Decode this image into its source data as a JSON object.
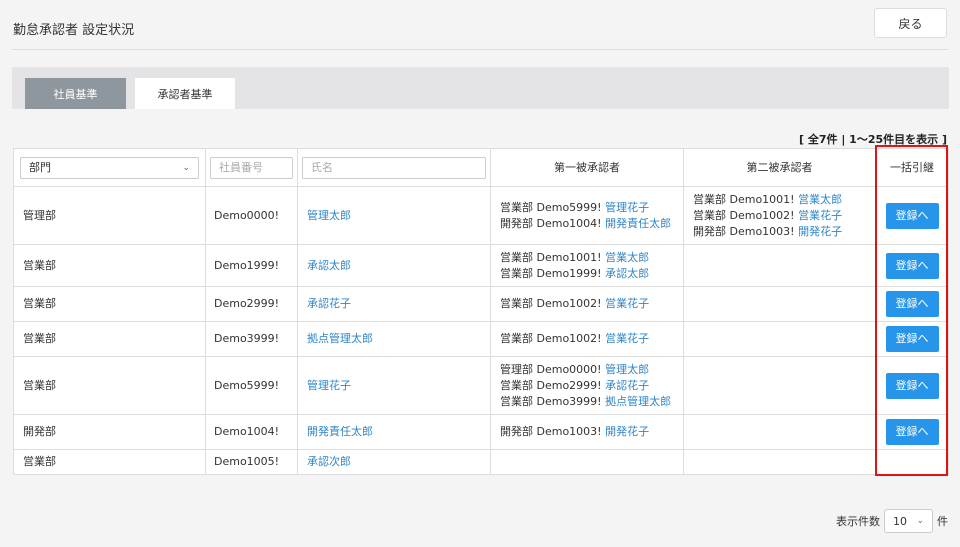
{
  "header": {
    "title": "勤怠承認者 設定状況",
    "back_label": "戻る"
  },
  "tabs": [
    {
      "label": "社員基準"
    },
    {
      "label": "承認者基準"
    }
  ],
  "count_text": "[ 全7件 | 1〜25件目を表示 ]",
  "filters": {
    "department": "部門",
    "employee_no_placeholder": "社員番号",
    "name_placeholder": "氏名"
  },
  "columns": {
    "first": "第一被承認者",
    "second": "第二被承認者",
    "bulk": "一括引継"
  },
  "register_label": "登録へ",
  "rows": [
    {
      "dept": "管理部",
      "id": "Demo0000!",
      "name": "管理太郎",
      "first": [
        {
          "prefix": "営業部 Demo5999!",
          "name": "管理花子"
        },
        {
          "prefix": "開発部 Demo1004!",
          "name": "開発責任太郎"
        }
      ],
      "second": [
        {
          "prefix": "営業部 Demo1001!",
          "name": "営業太郎"
        },
        {
          "prefix": "営業部 Demo1002!",
          "name": "営業花子"
        },
        {
          "prefix": "開発部 Demo1003!",
          "name": "開発花子"
        }
      ],
      "has_button": true
    },
    {
      "dept": "営業部",
      "id": "Demo1999!",
      "name": "承認太郎",
      "first": [
        {
          "prefix": "営業部 Demo1001!",
          "name": "営業太郎"
        },
        {
          "prefix": "営業部 Demo1999!",
          "name": "承認太郎"
        }
      ],
      "second": [],
      "has_button": true
    },
    {
      "dept": "営業部",
      "id": "Demo2999!",
      "name": "承認花子",
      "first": [
        {
          "prefix": "営業部 Demo1002!",
          "name": "営業花子"
        }
      ],
      "second": [],
      "has_button": true
    },
    {
      "dept": "営業部",
      "id": "Demo3999!",
      "name": "拠点管理太郎",
      "first": [
        {
          "prefix": "営業部 Demo1002!",
          "name": "営業花子"
        }
      ],
      "second": [],
      "has_button": true
    },
    {
      "dept": "営業部",
      "id": "Demo5999!",
      "name": "管理花子",
      "first": [
        {
          "prefix": "管理部 Demo0000!",
          "name": "管理太郎"
        },
        {
          "prefix": "営業部 Demo2999!",
          "name": "承認花子"
        },
        {
          "prefix": "営業部 Demo3999!",
          "name": "拠点管理太郎"
        }
      ],
      "second": [],
      "has_button": true
    },
    {
      "dept": "開発部",
      "id": "Demo1004!",
      "name": "開発責任太郎",
      "first": [
        {
          "prefix": "開発部 Demo1003!",
          "name": "開発花子"
        }
      ],
      "second": [],
      "has_button": true
    },
    {
      "dept": "営業部",
      "id": "Demo1005!",
      "name": "承認次郎",
      "first": [],
      "second": [],
      "has_button": false
    }
  ],
  "pager": {
    "label": "表示件数",
    "value": "10",
    "unit": "件"
  },
  "colors": {
    "link": "#2f86c9",
    "button": "#2795e9",
    "highlight": "#e01414"
  }
}
